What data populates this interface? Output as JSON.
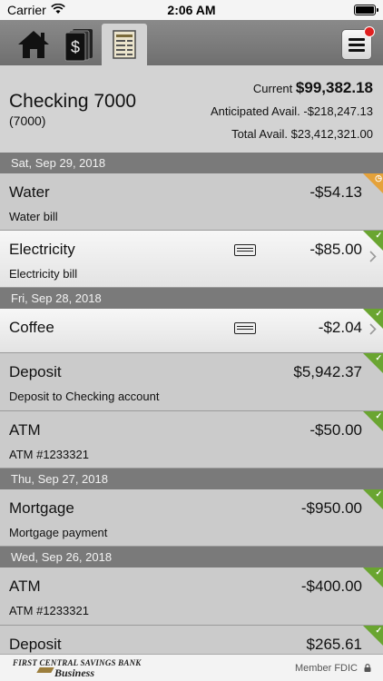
{
  "status_bar": {
    "carrier": "Carrier",
    "time": "2:06 AM"
  },
  "tabs": [
    {
      "id": "home",
      "icon": "home-icon"
    },
    {
      "id": "statement",
      "icon": "dollar-statement-icon"
    },
    {
      "id": "register",
      "icon": "register-ledger-icon",
      "active": true
    }
  ],
  "menu": {
    "icon": "hamburger-menu-icon",
    "notification": true
  },
  "account": {
    "name": "Checking 7000",
    "number": "(7000)",
    "current_label": "Current",
    "current_value": "$99,382.18",
    "anticipated_label": "Anticipated Avail.",
    "anticipated_value": "-$218,247.13",
    "total_label": "Total Avail.",
    "total_value": "$23,412,321.00"
  },
  "dates": [
    "Sat, Sep 29, 2018",
    "Fri, Sep 28, 2018",
    "Thu, Sep 27, 2018",
    "Wed, Sep 26, 2018"
  ],
  "transactions": [
    {
      "name": "Water",
      "amount": "-$54.13",
      "desc": "Water bill",
      "status": "pending",
      "card": false,
      "highlighted": false
    },
    {
      "name": "Electricity",
      "amount": "-$85.00",
      "desc": "Electricity bill",
      "status": "cleared",
      "card": true,
      "highlighted": true
    },
    {
      "name": "Coffee",
      "amount": "-$2.04",
      "desc": "",
      "status": "cleared",
      "card": true,
      "highlighted": true
    },
    {
      "name": "Deposit",
      "amount": "$5,942.37",
      "desc": "Deposit to Checking account",
      "status": "cleared",
      "card": false,
      "highlighted": false
    },
    {
      "name": "ATM",
      "amount": "-$50.00",
      "desc": "ATM #1233321",
      "status": "cleared",
      "card": false,
      "highlighted": false
    },
    {
      "name": "Mortgage",
      "amount": "-$950.00",
      "desc": "Mortgage payment",
      "status": "cleared",
      "card": false,
      "highlighted": false
    },
    {
      "name": "ATM",
      "amount": "-$400.00",
      "desc": "ATM #1233321",
      "status": "cleared",
      "card": false,
      "highlighted": false
    },
    {
      "name": "Deposit",
      "amount": "$265.61",
      "desc": "",
      "status": "cleared",
      "card": false,
      "highlighted": false
    }
  ],
  "footer": {
    "logo_line1": "FIRST CENTRAL SAVINGS BANK",
    "logo_line2": "Business",
    "member_fdic": "Member FDIC",
    "lock_icon": "lock-icon"
  },
  "colors": {
    "cleared": "#6aa531",
    "pending": "#e5a23a",
    "notification": "#e02020"
  }
}
